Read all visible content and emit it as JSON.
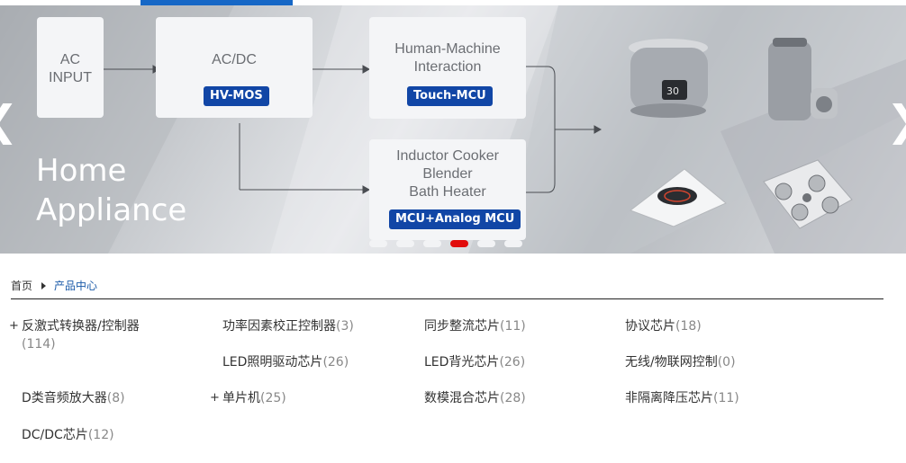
{
  "banner": {
    "boxes": {
      "ac_input": "AC\nINPUT",
      "acdc": "AC/DC",
      "hmi": "Human-Machine\nInteraction",
      "appliances": "Inductor Cooker\nBlender\nBath Heater"
    },
    "tags": {
      "hv_mos": "HV-MOS",
      "touch_mcu": "Touch-MCU",
      "mcu_analog": "MCU+Analog MCU"
    },
    "title": "Home\nAppliance",
    "prev_icon": "chevron-left-icon",
    "next_icon": "chevron-right-icon",
    "slides_count": 6,
    "active_slide": 4,
    "colors": {
      "tag": "#1146a6",
      "active_dot": "#e10b0b",
      "accent": "#1667c6"
    }
  },
  "breadcrumb": {
    "home": "首页",
    "current": "产品中心"
  },
  "categories": [
    {
      "name": "反激式转换器/控制器",
      "count": "(114)",
      "expandable": true
    },
    {
      "name": "功率因素校正控制器",
      "count": "(3)"
    },
    {
      "name": "同步整流芯片",
      "count": "(11)"
    },
    {
      "name": "协议芯片",
      "count": "(18)"
    },
    {
      "name": "LED照明驱动芯片",
      "count": "(26)"
    },
    {
      "name": "LED背光芯片",
      "count": "(26)"
    },
    {
      "name": "无线/物联网控制",
      "count": "(0)"
    },
    {
      "name": "D类音频放大器",
      "count": "(8)"
    },
    {
      "name": "单片机",
      "count": "(25)",
      "expandable": true
    },
    {
      "name": "数模混合芯片",
      "count": "(28)"
    },
    {
      "name": "非隔离降压芯片",
      "count": "(11)"
    },
    {
      "name": "DC/DC芯片",
      "count": "(12)"
    }
  ]
}
